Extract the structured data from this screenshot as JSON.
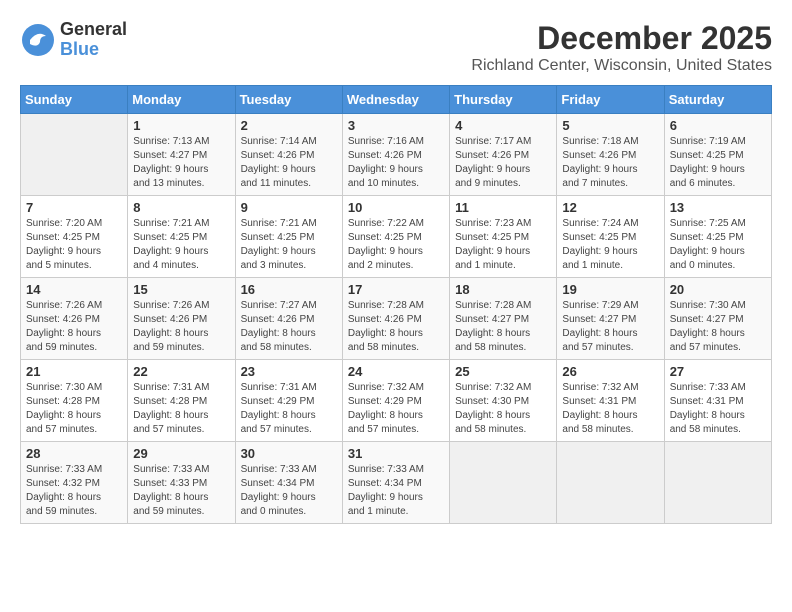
{
  "app": {
    "logo_general": "General",
    "logo_blue": "Blue"
  },
  "calendar": {
    "month_year": "December 2025",
    "location": "Richland Center, Wisconsin, United States",
    "days_of_week": [
      "Sunday",
      "Monday",
      "Tuesday",
      "Wednesday",
      "Thursday",
      "Friday",
      "Saturday"
    ],
    "weeks": [
      [
        {
          "day": "",
          "info": ""
        },
        {
          "day": "1",
          "info": "Sunrise: 7:13 AM\nSunset: 4:27 PM\nDaylight: 9 hours\nand 13 minutes."
        },
        {
          "day": "2",
          "info": "Sunrise: 7:14 AM\nSunset: 4:26 PM\nDaylight: 9 hours\nand 11 minutes."
        },
        {
          "day": "3",
          "info": "Sunrise: 7:16 AM\nSunset: 4:26 PM\nDaylight: 9 hours\nand 10 minutes."
        },
        {
          "day": "4",
          "info": "Sunrise: 7:17 AM\nSunset: 4:26 PM\nDaylight: 9 hours\nand 9 minutes."
        },
        {
          "day": "5",
          "info": "Sunrise: 7:18 AM\nSunset: 4:26 PM\nDaylight: 9 hours\nand 7 minutes."
        },
        {
          "day": "6",
          "info": "Sunrise: 7:19 AM\nSunset: 4:25 PM\nDaylight: 9 hours\nand 6 minutes."
        }
      ],
      [
        {
          "day": "7",
          "info": "Sunrise: 7:20 AM\nSunset: 4:25 PM\nDaylight: 9 hours\nand 5 minutes."
        },
        {
          "day": "8",
          "info": "Sunrise: 7:21 AM\nSunset: 4:25 PM\nDaylight: 9 hours\nand 4 minutes."
        },
        {
          "day": "9",
          "info": "Sunrise: 7:21 AM\nSunset: 4:25 PM\nDaylight: 9 hours\nand 3 minutes."
        },
        {
          "day": "10",
          "info": "Sunrise: 7:22 AM\nSunset: 4:25 PM\nDaylight: 9 hours\nand 2 minutes."
        },
        {
          "day": "11",
          "info": "Sunrise: 7:23 AM\nSunset: 4:25 PM\nDaylight: 9 hours\nand 1 minute."
        },
        {
          "day": "12",
          "info": "Sunrise: 7:24 AM\nSunset: 4:25 PM\nDaylight: 9 hours\nand 1 minute."
        },
        {
          "day": "13",
          "info": "Sunrise: 7:25 AM\nSunset: 4:25 PM\nDaylight: 9 hours\nand 0 minutes."
        }
      ],
      [
        {
          "day": "14",
          "info": "Sunrise: 7:26 AM\nSunset: 4:26 PM\nDaylight: 8 hours\nand 59 minutes."
        },
        {
          "day": "15",
          "info": "Sunrise: 7:26 AM\nSunset: 4:26 PM\nDaylight: 8 hours\nand 59 minutes."
        },
        {
          "day": "16",
          "info": "Sunrise: 7:27 AM\nSunset: 4:26 PM\nDaylight: 8 hours\nand 58 minutes."
        },
        {
          "day": "17",
          "info": "Sunrise: 7:28 AM\nSunset: 4:26 PM\nDaylight: 8 hours\nand 58 minutes."
        },
        {
          "day": "18",
          "info": "Sunrise: 7:28 AM\nSunset: 4:27 PM\nDaylight: 8 hours\nand 58 minutes."
        },
        {
          "day": "19",
          "info": "Sunrise: 7:29 AM\nSunset: 4:27 PM\nDaylight: 8 hours\nand 57 minutes."
        },
        {
          "day": "20",
          "info": "Sunrise: 7:30 AM\nSunset: 4:27 PM\nDaylight: 8 hours\nand 57 minutes."
        }
      ],
      [
        {
          "day": "21",
          "info": "Sunrise: 7:30 AM\nSunset: 4:28 PM\nDaylight: 8 hours\nand 57 minutes."
        },
        {
          "day": "22",
          "info": "Sunrise: 7:31 AM\nSunset: 4:28 PM\nDaylight: 8 hours\nand 57 minutes."
        },
        {
          "day": "23",
          "info": "Sunrise: 7:31 AM\nSunset: 4:29 PM\nDaylight: 8 hours\nand 57 minutes."
        },
        {
          "day": "24",
          "info": "Sunrise: 7:32 AM\nSunset: 4:29 PM\nDaylight: 8 hours\nand 57 minutes."
        },
        {
          "day": "25",
          "info": "Sunrise: 7:32 AM\nSunset: 4:30 PM\nDaylight: 8 hours\nand 58 minutes."
        },
        {
          "day": "26",
          "info": "Sunrise: 7:32 AM\nSunset: 4:31 PM\nDaylight: 8 hours\nand 58 minutes."
        },
        {
          "day": "27",
          "info": "Sunrise: 7:33 AM\nSunset: 4:31 PM\nDaylight: 8 hours\nand 58 minutes."
        }
      ],
      [
        {
          "day": "28",
          "info": "Sunrise: 7:33 AM\nSunset: 4:32 PM\nDaylight: 8 hours\nand 59 minutes."
        },
        {
          "day": "29",
          "info": "Sunrise: 7:33 AM\nSunset: 4:33 PM\nDaylight: 8 hours\nand 59 minutes."
        },
        {
          "day": "30",
          "info": "Sunrise: 7:33 AM\nSunset: 4:34 PM\nDaylight: 9 hours\nand 0 minutes."
        },
        {
          "day": "31",
          "info": "Sunrise: 7:33 AM\nSunset: 4:34 PM\nDaylight: 9 hours\nand 1 minute."
        },
        {
          "day": "",
          "info": ""
        },
        {
          "day": "",
          "info": ""
        },
        {
          "day": "",
          "info": ""
        }
      ]
    ]
  }
}
